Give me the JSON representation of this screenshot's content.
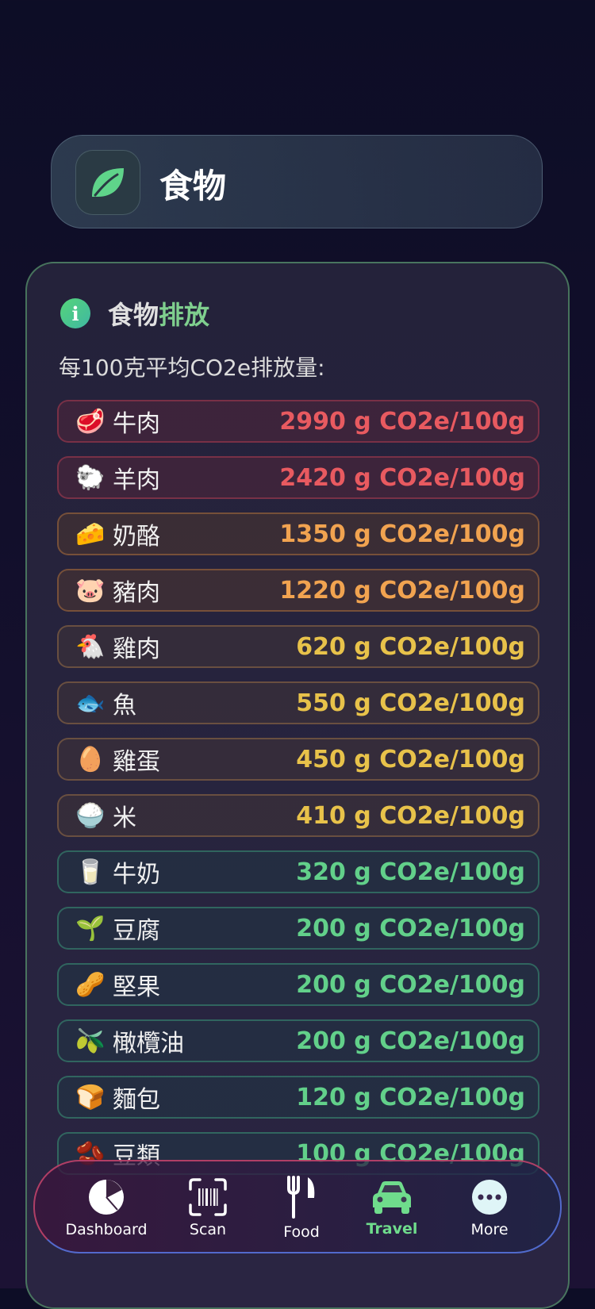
{
  "header": {
    "title": "食物",
    "icon": "leaf-icon"
  },
  "panel": {
    "title_part1": "食物",
    "title_part2": "排放",
    "subtitle": "每100克平均CO2e排放量:",
    "items": [
      {
        "emoji": "🥩",
        "name": "牛肉",
        "value": "2990 g CO2e/100g"
      },
      {
        "emoji": "🐑",
        "name": "羊肉",
        "value": "2420 g CO2e/100g"
      },
      {
        "emoji": "🧀",
        "name": "奶酪",
        "value": "1350 g CO2e/100g"
      },
      {
        "emoji": "🐷",
        "name": "豬肉",
        "value": "1220 g CO2e/100g"
      },
      {
        "emoji": "🐔",
        "name": "雞肉",
        "value": "620 g CO2e/100g"
      },
      {
        "emoji": "🐟",
        "name": "魚",
        "value": "550 g CO2e/100g"
      },
      {
        "emoji": "🥚",
        "name": "雞蛋",
        "value": "450 g CO2e/100g"
      },
      {
        "emoji": "🍚",
        "name": "米",
        "value": "410 g CO2e/100g"
      },
      {
        "emoji": "🥛",
        "name": "牛奶",
        "value": "320 g CO2e/100g"
      },
      {
        "emoji": "🌱",
        "name": "豆腐",
        "value": "200 g CO2e/100g"
      },
      {
        "emoji": "🥜",
        "name": "堅果",
        "value": "200 g CO2e/100g"
      },
      {
        "emoji": "🫒",
        "name": "橄欖油",
        "value": "200 g CO2e/100g"
      },
      {
        "emoji": "🍞",
        "name": "麵包",
        "value": "120 g CO2e/100g"
      },
      {
        "emoji": "🫘",
        "name": "豆類",
        "value": "100 g CO2e/100g"
      }
    ]
  },
  "tabs": [
    {
      "label": "Dashboard",
      "icon": "pie-chart-icon"
    },
    {
      "label": "Scan",
      "icon": "barcode-scan-icon"
    },
    {
      "label": "Food",
      "icon": "fork-knife-icon"
    },
    {
      "label": "Travel",
      "icon": "car-icon",
      "active": true
    },
    {
      "label": "More",
      "icon": "more-dots-icon"
    }
  ]
}
